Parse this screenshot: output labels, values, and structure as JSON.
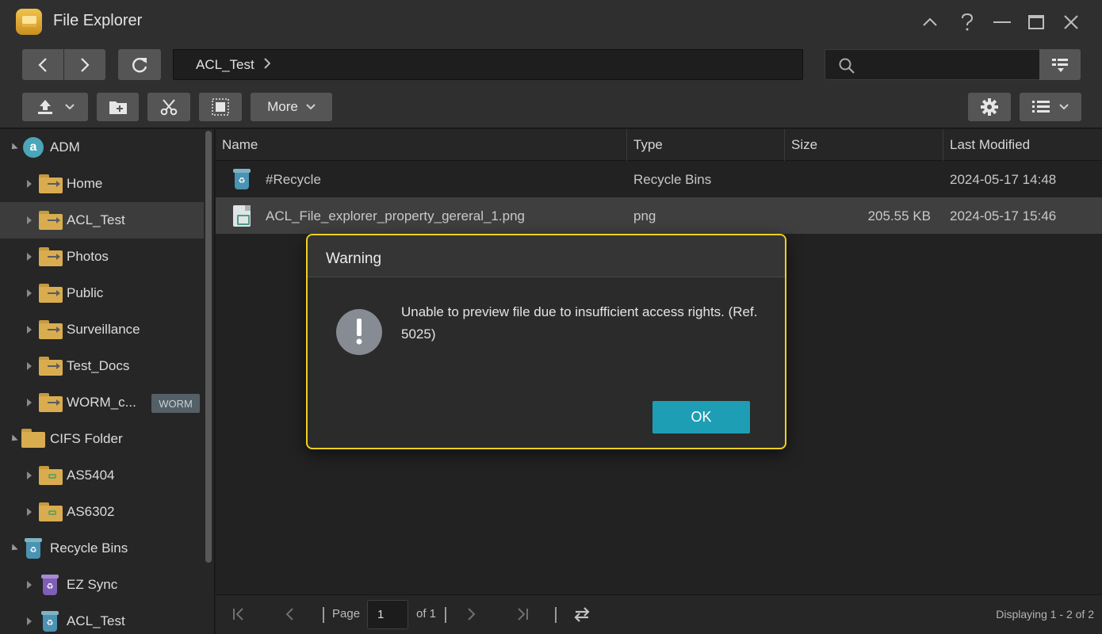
{
  "window": {
    "title": "File Explorer"
  },
  "path": {
    "current": "ACL_Test"
  },
  "search": {
    "value": "",
    "placeholder": ""
  },
  "toolbar": {
    "more_label": "More"
  },
  "sidebar": {
    "items": [
      {
        "label": "ADM",
        "level": 0,
        "icon": "adm-icon",
        "expanded": true
      },
      {
        "label": "Home",
        "level": 1,
        "icon": "folder-icon"
      },
      {
        "label": "ACL_Test",
        "level": 1,
        "icon": "folder-icon",
        "selected": true
      },
      {
        "label": "Photos",
        "level": 1,
        "icon": "folder-icon"
      },
      {
        "label": "Public",
        "level": 1,
        "icon": "folder-icon"
      },
      {
        "label": "Surveillance",
        "level": 1,
        "icon": "folder-icon"
      },
      {
        "label": "Test_Docs",
        "level": 1,
        "icon": "folder-icon"
      },
      {
        "label": "WORM_c...",
        "level": 1,
        "icon": "folder-icon",
        "badge": "WORM"
      },
      {
        "label": "CIFS Folder",
        "level": 0,
        "icon": "cifs-folder-icon",
        "expanded": true
      },
      {
        "label": "AS5404",
        "level": 1,
        "icon": "network-folder-icon"
      },
      {
        "label": "AS6302",
        "level": 1,
        "icon": "network-folder-icon"
      },
      {
        "label": "Recycle Bins",
        "level": 0,
        "icon": "recycle-bin-icon",
        "expanded": true
      },
      {
        "label": "EZ Sync",
        "level": 1,
        "icon": "recycle-bin-purple-icon"
      },
      {
        "label": "ACL_Test",
        "level": 1,
        "icon": "recycle-bin-icon"
      }
    ]
  },
  "list": {
    "columns": [
      "Name",
      "Type",
      "Size",
      "Last Modified"
    ],
    "rows": [
      {
        "name": "#Recycle",
        "type": "Recycle Bins",
        "size": "",
        "modified": "2024-05-17 14:48",
        "icon": "recycle-bin-icon"
      },
      {
        "name": "ACL_File_explorer_property_gereral_1.png",
        "type": "png",
        "size": "205.55 KB",
        "modified": "2024-05-17 15:46",
        "icon": "image-file-icon",
        "selected": true
      }
    ]
  },
  "pager": {
    "page_label": "Page",
    "page_value": "1",
    "of_label": "of 1",
    "display_text": "Displaying 1 - 2 of 2"
  },
  "dialog": {
    "title": "Warning",
    "message": "Unable to preview file due to insufficient access rights. (Ref. 5025)",
    "ok_label": "OK"
  },
  "colors": {
    "dialog_border": "#f2cf1e",
    "ok_button": "#1e9eb4",
    "folder": "#d9ad4f"
  }
}
